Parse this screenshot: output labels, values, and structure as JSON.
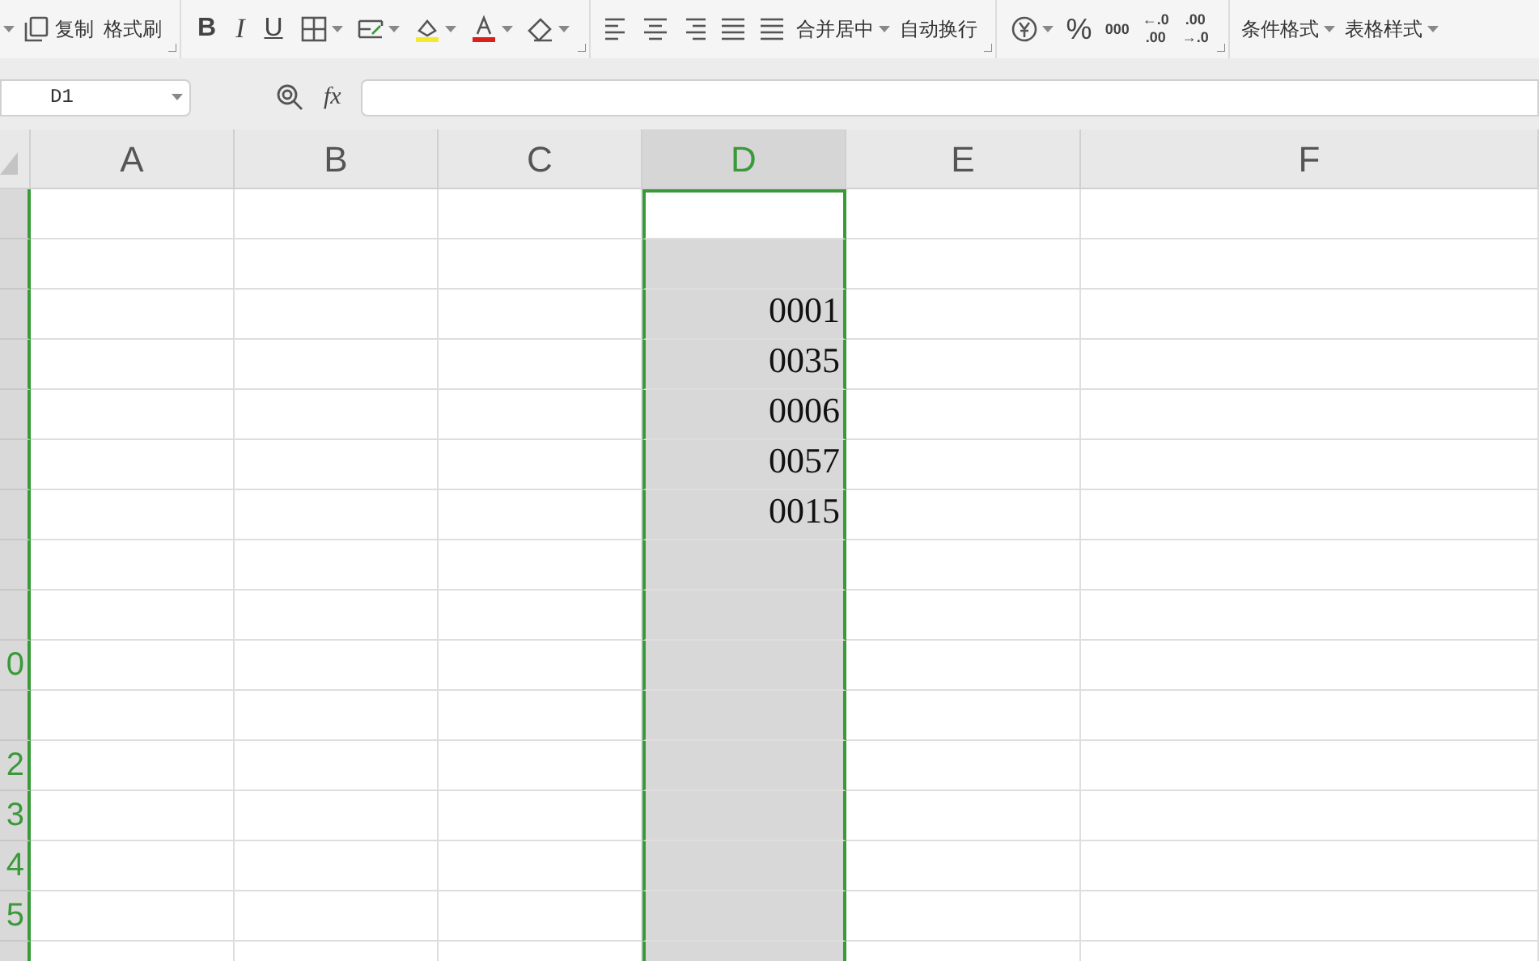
{
  "toolbar": {
    "groups": [
      {
        "items": [
          {
            "kind": "caret"
          },
          {
            "kind": "copy",
            "label": "复制"
          },
          {
            "kind": "text",
            "label": "格式刷"
          }
        ]
      },
      {
        "items": [
          {
            "kind": "bold",
            "label": "B"
          },
          {
            "kind": "italic",
            "label": "I"
          },
          {
            "kind": "underline",
            "label": "U"
          },
          {
            "kind": "borders"
          },
          {
            "kind": "cell-style"
          },
          {
            "kind": "fill-color"
          },
          {
            "kind": "font-color"
          },
          {
            "kind": "eraser"
          }
        ]
      },
      {
        "items": [
          {
            "kind": "align-left"
          },
          {
            "kind": "align-center"
          },
          {
            "kind": "align-right"
          },
          {
            "kind": "justify"
          },
          {
            "kind": "distribute"
          },
          {
            "kind": "dropdown-text",
            "label": "合并居中"
          },
          {
            "kind": "text",
            "label": "自动换行"
          }
        ]
      },
      {
        "items": [
          {
            "kind": "currency"
          },
          {
            "kind": "percent",
            "label": "%"
          },
          {
            "kind": "thousands",
            "label": "000"
          },
          {
            "kind": "decimals",
            "lines": [
              "←.0",
              ".00"
            ]
          },
          {
            "kind": "decimals",
            "lines": [
              ".00",
              "→.0"
            ]
          }
        ]
      },
      {
        "items": [
          {
            "kind": "dropdown-text",
            "label": "条件格式"
          },
          {
            "kind": "dropdown-text",
            "label": "表格样式"
          }
        ]
      }
    ]
  },
  "formula_bar": {
    "name_box": "D1",
    "fx": "fx"
  },
  "sheet": {
    "columns": [
      {
        "label": "A",
        "selected": false
      },
      {
        "label": "B",
        "selected": false
      },
      {
        "label": "C",
        "selected": false
      },
      {
        "label": "D",
        "selected": true
      },
      {
        "label": "E",
        "selected": false
      },
      {
        "label": "F",
        "selected": false
      }
    ],
    "rows": [
      {
        "header": "",
        "cells": [
          "",
          "",
          "",
          "",
          "",
          ""
        ]
      },
      {
        "header": "",
        "cells": [
          "",
          "",
          "",
          "",
          "",
          ""
        ]
      },
      {
        "header": "",
        "cells": [
          "",
          "",
          "",
          "0001",
          "",
          ""
        ]
      },
      {
        "header": "",
        "cells": [
          "",
          "",
          "",
          "0035",
          "",
          ""
        ]
      },
      {
        "header": "",
        "cells": [
          "",
          "",
          "",
          "0006",
          "",
          ""
        ]
      },
      {
        "header": "",
        "cells": [
          "",
          "",
          "",
          "0057",
          "",
          ""
        ]
      },
      {
        "header": "",
        "cells": [
          "",
          "",
          "",
          "0015",
          "",
          ""
        ]
      },
      {
        "header": "",
        "cells": [
          "",
          "",
          "",
          "",
          "",
          ""
        ]
      },
      {
        "header": "",
        "cells": [
          "",
          "",
          "",
          "",
          "",
          ""
        ]
      },
      {
        "header": "0",
        "cells": [
          "",
          "",
          "",
          "",
          "",
          ""
        ]
      },
      {
        "header": "",
        "cells": [
          "",
          "",
          "",
          "",
          "",
          ""
        ]
      },
      {
        "header": "2",
        "cells": [
          "",
          "",
          "",
          "",
          "",
          ""
        ]
      },
      {
        "header": "3",
        "cells": [
          "",
          "",
          "",
          "",
          "",
          ""
        ]
      },
      {
        "header": "4",
        "cells": [
          "",
          "",
          "",
          "",
          "",
          ""
        ]
      },
      {
        "header": "5",
        "cells": [
          "",
          "",
          "",
          "",
          "",
          ""
        ]
      },
      {
        "header": "",
        "cells": [
          "",
          "",
          "",
          "",
          "",
          ""
        ]
      }
    ]
  }
}
